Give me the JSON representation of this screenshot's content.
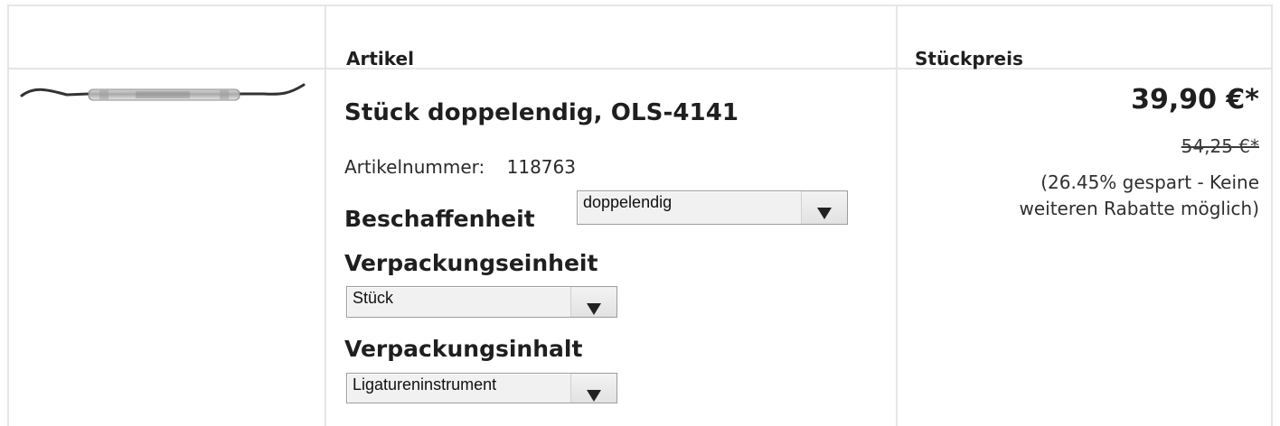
{
  "table": {
    "headers": {
      "image": "",
      "article": "Artikel",
      "unit_price": "Stückpreis"
    }
  },
  "product": {
    "image_alt": "Dental instrument image",
    "title": "Stück doppelendig, OLS-4141",
    "article_number_label": "Artikelnummer:",
    "article_number": "118763",
    "options": {
      "beschaffenheit": {
        "label": "Beschaffenheit",
        "selected": "doppelendig"
      },
      "verpackungseinheit": {
        "label": "Verpackungseinheit",
        "selected": "Stück"
      },
      "verpackungsinhalt": {
        "label": "Verpackungsinhalt",
        "selected": "Ligatureninstrument"
      }
    },
    "price": {
      "current": "39,90 €*",
      "old": "54,25 €*",
      "saving_note": "(26.45% gespart - Keine weiteren Rabatte möglich)"
    }
  },
  "icons": {
    "dropdown_arrow": "triangle-down"
  },
  "colors": {
    "text": "#1f1f1f",
    "border": "#e6e6e6",
    "select_bg": "#f1f1f1"
  }
}
